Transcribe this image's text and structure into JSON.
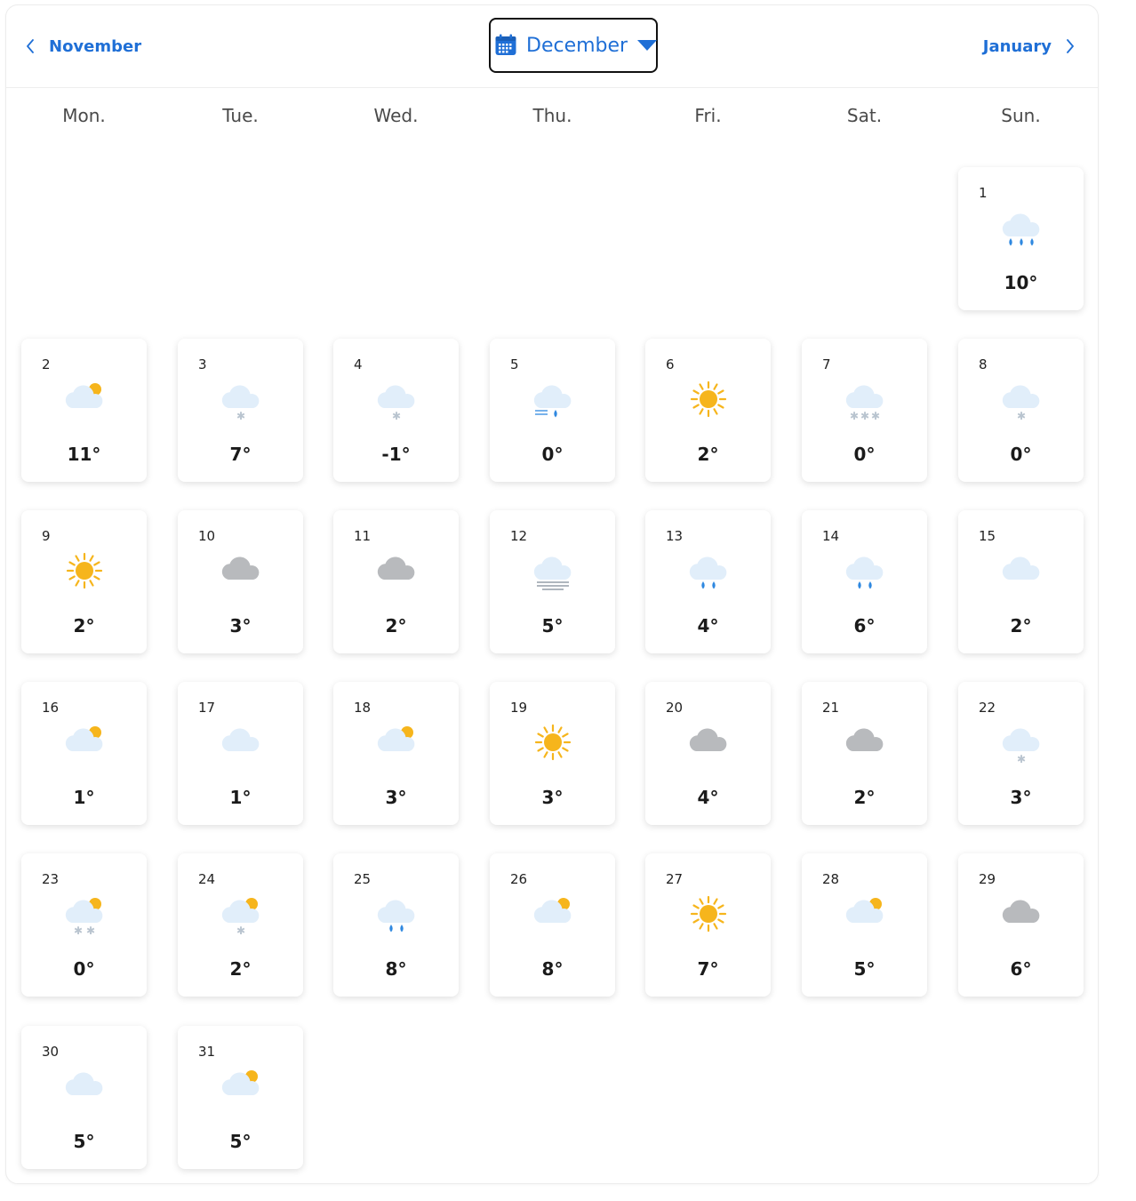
{
  "nav": {
    "prev_label": "November",
    "next_label": "January",
    "current_month": "December"
  },
  "weekdays": [
    "Mon.",
    "Tue.",
    "Wed.",
    "Thu.",
    "Fri.",
    "Sat.",
    "Sun."
  ],
  "colors": {
    "accent": "#1f6fd6",
    "sun": "#f6b51c",
    "cloud_light": "#e1eefa",
    "cloud_gray": "#b8babd",
    "rain": "#2f88e0",
    "snow": "#b9c4cf"
  },
  "days": [
    {
      "day": "1",
      "temp": "10°",
      "icon": "rain-heavy-icon"
    },
    {
      "day": "2",
      "temp": "11°",
      "icon": "partly-sunny-icon"
    },
    {
      "day": "3",
      "temp": "7°",
      "icon": "snow-light-icon"
    },
    {
      "day": "4",
      "temp": "-1°",
      "icon": "snow-light-icon"
    },
    {
      "day": "5",
      "temp": "0°",
      "icon": "drizzle-wind-icon"
    },
    {
      "day": "6",
      "temp": "2°",
      "icon": "sun-icon"
    },
    {
      "day": "7",
      "temp": "0°",
      "icon": "snow-heavy-icon"
    },
    {
      "day": "8",
      "temp": "0°",
      "icon": "snow-light-icon"
    },
    {
      "day": "9",
      "temp": "2°",
      "icon": "sun-icon"
    },
    {
      "day": "10",
      "temp": "3°",
      "icon": "cloud-gray-icon"
    },
    {
      "day": "11",
      "temp": "2°",
      "icon": "cloud-gray-icon"
    },
    {
      "day": "12",
      "temp": "5°",
      "icon": "fog-icon"
    },
    {
      "day": "13",
      "temp": "4°",
      "icon": "rain-icon"
    },
    {
      "day": "14",
      "temp": "6°",
      "icon": "rain-icon"
    },
    {
      "day": "15",
      "temp": "2°",
      "icon": "cloud-icon"
    },
    {
      "day": "16",
      "temp": "1°",
      "icon": "partly-sunny-icon"
    },
    {
      "day": "17",
      "temp": "1°",
      "icon": "cloud-icon"
    },
    {
      "day": "18",
      "temp": "3°",
      "icon": "partly-sunny-icon"
    },
    {
      "day": "19",
      "temp": "3°",
      "icon": "sun-icon"
    },
    {
      "day": "20",
      "temp": "4°",
      "icon": "cloud-gray-icon"
    },
    {
      "day": "21",
      "temp": "2°",
      "icon": "cloud-gray-icon"
    },
    {
      "day": "22",
      "temp": "3°",
      "icon": "snow-light-icon"
    },
    {
      "day": "23",
      "temp": "0°",
      "icon": "partly-sunny-snow-icon"
    },
    {
      "day": "24",
      "temp": "2°",
      "icon": "partly-sunny-snow-light-icon"
    },
    {
      "day": "25",
      "temp": "8°",
      "icon": "rain-icon"
    },
    {
      "day": "26",
      "temp": "8°",
      "icon": "partly-sunny-icon"
    },
    {
      "day": "27",
      "temp": "7°",
      "icon": "sun-icon"
    },
    {
      "day": "28",
      "temp": "5°",
      "icon": "partly-sunny-icon"
    },
    {
      "day": "29",
      "temp": "6°",
      "icon": "cloud-gray-icon"
    },
    {
      "day": "30",
      "temp": "5°",
      "icon": "cloud-icon"
    },
    {
      "day": "31",
      "temp": "5°",
      "icon": "partly-sunny-icon"
    }
  ]
}
